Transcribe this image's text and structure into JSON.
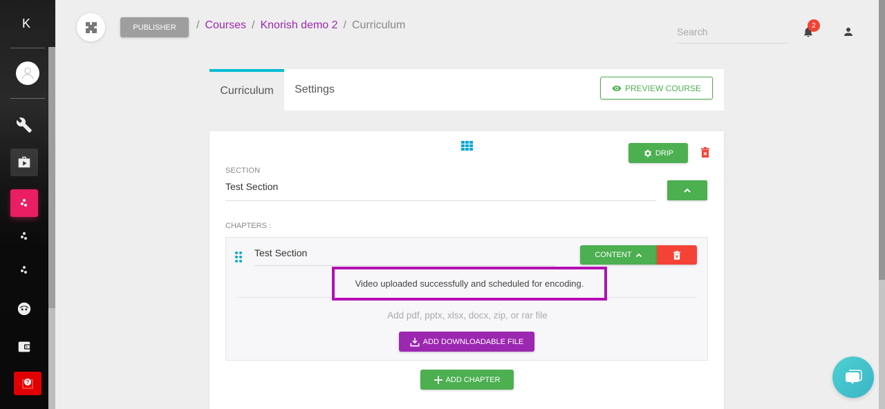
{
  "sidebar": {
    "logo": "K",
    "items": [
      {
        "name": "avatar",
        "icon": "user-circle-icon"
      },
      {
        "name": "tools",
        "icon": "wrench-icon"
      },
      {
        "name": "media",
        "icon": "briefcase-play-icon"
      },
      {
        "name": "hub-active",
        "icon": "dots-cluster-icon",
        "active": true
      },
      {
        "name": "hub-2",
        "icon": "dots-cluster-icon"
      },
      {
        "name": "hub-3",
        "icon": "dots-cluster-icon"
      },
      {
        "name": "face",
        "icon": "face-icon"
      },
      {
        "name": "wallet",
        "icon": "wallet-icon"
      },
      {
        "name": "help",
        "icon": "help-icon"
      }
    ]
  },
  "header": {
    "publisher_label": "PUBLISHER",
    "breadcrumb": [
      {
        "label": "Courses",
        "link": true
      },
      {
        "label": "Knorish demo 2",
        "link": true
      },
      {
        "label": "Curriculum",
        "link": false
      }
    ],
    "separator": "/",
    "search_placeholder": "Search",
    "notification_count": "2"
  },
  "tabs": {
    "items": [
      {
        "label": "Curriculum",
        "active": true
      },
      {
        "label": "Settings",
        "active": false
      }
    ],
    "preview_label": "PREVIEW COURSE"
  },
  "section": {
    "drip_label": "DRIP",
    "section_label": "SECTION",
    "section_value": "Test Section",
    "chapters_label": "CHAPTERS :",
    "chapter": {
      "title_value": "Test Section",
      "content_label": "CONTENT",
      "status_message": "Video uploaded successfully and scheduled for encoding.",
      "file_hint": "Add pdf, pptx, xlsx, docx, zip, or rar file",
      "download_label": "ADD DOWNLOADABLE FILE"
    },
    "add_chapter_label": "ADD CHAPTER"
  },
  "colors": {
    "accent_tab": "#00bcd4",
    "green": "#4caf50",
    "red": "#f44336",
    "purple": "#9c27b0",
    "active_sidebar": "#e91e63",
    "highlight_border": "#b40fb4"
  }
}
